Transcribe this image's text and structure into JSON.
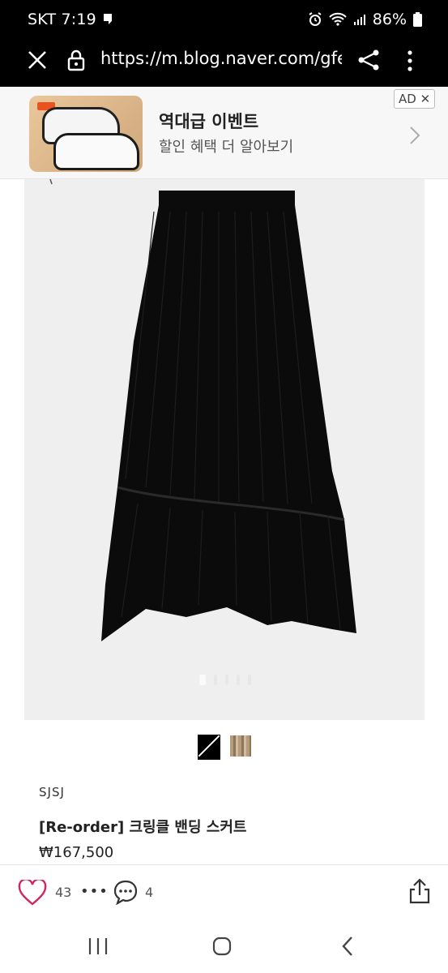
{
  "status": {
    "carrier_time": "SKT 7:19",
    "battery": "86%"
  },
  "browser": {
    "url": "https://m.blog.naver.com/gfe"
  },
  "ad": {
    "badge": "AD",
    "title": "역대급 이벤트",
    "subtitle": "할인 혜택 더 알아보기"
  },
  "product": {
    "brand": "SJSJ",
    "name": "[Re-order] 크링클 밴딩 스커트",
    "price": "₩167,500",
    "image_pages": 5,
    "image_current": 1
  },
  "actions": {
    "likes": "43",
    "more": "•••",
    "comments": "4"
  },
  "colors": {
    "status_bg": "#000000",
    "photo_bg": "#efefef",
    "skirt": "#0b0b0b",
    "heart": "#d3265f"
  }
}
